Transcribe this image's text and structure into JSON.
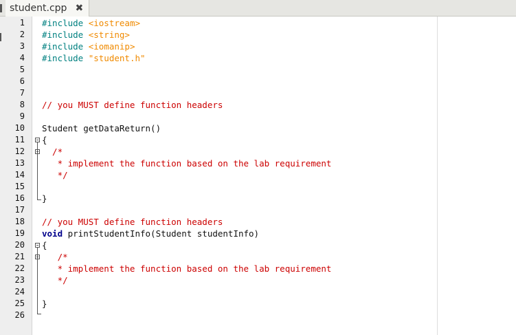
{
  "tab": {
    "filename": "student.cpp",
    "close_glyph": "✖"
  },
  "lines": [
    {
      "n": "1",
      "tokens": [
        {
          "t": "#include ",
          "c": "kw-pp"
        },
        {
          "t": "<iostream>",
          "c": "str"
        }
      ]
    },
    {
      "n": "2",
      "tokens": [
        {
          "t": "#include ",
          "c": "kw-pp"
        },
        {
          "t": "<string>",
          "c": "str"
        }
      ]
    },
    {
      "n": "3",
      "tokens": [
        {
          "t": "#include ",
          "c": "kw-pp"
        },
        {
          "t": "<iomanip>",
          "c": "str"
        }
      ]
    },
    {
      "n": "4",
      "tokens": [
        {
          "t": "#include ",
          "c": "kw-pp"
        },
        {
          "t": "\"student.h\"",
          "c": "str"
        }
      ]
    },
    {
      "n": "5",
      "tokens": []
    },
    {
      "n": "6",
      "tokens": []
    },
    {
      "n": "7",
      "tokens": []
    },
    {
      "n": "8",
      "tokens": [
        {
          "t": "// you MUST define function headers",
          "c": "cm"
        }
      ]
    },
    {
      "n": "9",
      "tokens": []
    },
    {
      "n": "10",
      "tokens": [
        {
          "t": "Student getDataReturn()",
          "c": ""
        }
      ]
    },
    {
      "n": "11",
      "tokens": [
        {
          "t": "{",
          "c": ""
        }
      ]
    },
    {
      "n": "12",
      "tokens": [
        {
          "t": "  /*",
          "c": "cm"
        }
      ]
    },
    {
      "n": "13",
      "tokens": [
        {
          "t": "   * implement the function based on the lab requirement",
          "c": "cm"
        }
      ]
    },
    {
      "n": "14",
      "tokens": [
        {
          "t": "   */",
          "c": "cm"
        }
      ]
    },
    {
      "n": "15",
      "tokens": []
    },
    {
      "n": "16",
      "tokens": [
        {
          "t": "}",
          "c": ""
        }
      ]
    },
    {
      "n": "17",
      "tokens": []
    },
    {
      "n": "18",
      "tokens": [
        {
          "t": "// you MUST define function headers",
          "c": "cm"
        }
      ]
    },
    {
      "n": "19",
      "tokens": [
        {
          "t": "void",
          "c": "kw"
        },
        {
          "t": " printStudentInfo(Student studentInfo)",
          "c": ""
        }
      ]
    },
    {
      "n": "20",
      "tokens": [
        {
          "t": "{",
          "c": ""
        }
      ]
    },
    {
      "n": "21",
      "tokens": [
        {
          "t": "   /*",
          "c": "cm"
        }
      ]
    },
    {
      "n": "22",
      "tokens": [
        {
          "t": "   * implement the function based on the lab requirement",
          "c": "cm"
        }
      ]
    },
    {
      "n": "23",
      "tokens": [
        {
          "t": "   */",
          "c": "cm"
        }
      ]
    },
    {
      "n": "24",
      "tokens": []
    },
    {
      "n": "25",
      "tokens": [
        {
          "t": "}",
          "c": ""
        }
      ]
    },
    {
      "n": "26",
      "tokens": []
    }
  ]
}
